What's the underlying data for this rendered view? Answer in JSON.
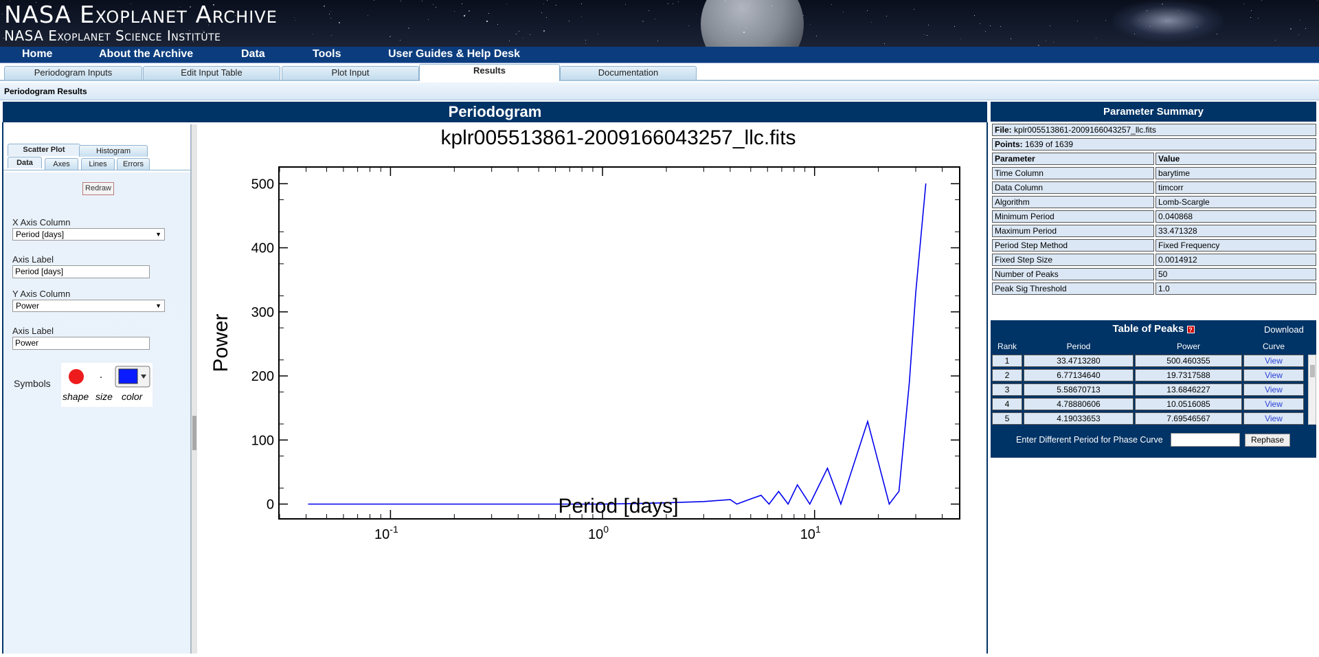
{
  "site": {
    "title": "NASA Exoplanet Archive",
    "subtitle": "NASA Exoplanet Science Institute"
  },
  "nav": [
    "Home",
    "About the Archive",
    "Data",
    "Tools",
    "User Guides & Help Desk"
  ],
  "tabs": [
    "Periodogram Inputs",
    "Edit Input Table",
    "Plot Input",
    "Results",
    "Documentation"
  ],
  "active_tab": "Results",
  "results_bar": "Periodogram Results",
  "main_header": "Periodogram",
  "controls": {
    "plot_tabs": [
      "Scatter Plot",
      "Histogram"
    ],
    "sub_tabs": [
      "Data",
      "Axes",
      "Lines",
      "Errors"
    ],
    "redraw": "Redraw",
    "x_axis_column_label": "X Axis Column",
    "x_axis_column_value": "Period [days]",
    "x_axis_label_label": "Axis Label",
    "x_axis_label_value": "Period [days]",
    "y_axis_column_label": "Y Axis Column",
    "y_axis_column_value": "Power",
    "y_axis_label_label": "Axis Label",
    "y_axis_label_value": "Power",
    "symbols_label": "Symbols",
    "symbol_shape": "shape",
    "symbol_size": "size",
    "symbol_color": "color",
    "symbol_shape_color": "#ee1c1c",
    "symbol_fill_color": "#0a1cff"
  },
  "plot": {
    "title": "kplr005513861-2009166043257_llc.fits",
    "line_color": "#0000ee"
  },
  "chart_data": {
    "type": "line",
    "title": "kplr005513861-2009166043257_llc.fits",
    "xlabel": "Period [days]",
    "ylabel": "Power",
    "xscale": "log",
    "xlim": [
      0.03,
      48
    ],
    "ylim": [
      -22,
      525
    ],
    "yticks": [
      0,
      100,
      200,
      300,
      400,
      500
    ],
    "xtick_labels": [
      "10^-1",
      "10^0",
      "10^1"
    ],
    "grid": false,
    "series": [
      {
        "x": [
          0.0409,
          1.0,
          1.5,
          2.0,
          3.0,
          4.0,
          4.3,
          5.0,
          5.59,
          6.1,
          6.77,
          7.5,
          8.3,
          9.5,
          11.5,
          13.3,
          17.8,
          22.5,
          25.0,
          28.0,
          30.0,
          33.47
        ],
        "y": [
          0,
          0,
          1,
          2,
          4,
          7,
          0,
          8,
          13.7,
          0,
          19.7,
          0,
          30,
          0,
          56,
          0,
          129,
          0,
          20,
          190,
          330,
          500.46
        ]
      }
    ]
  },
  "summary": {
    "header": "Parameter Summary",
    "file_label": "File:",
    "file_value": "kplr005513861-2009166043257_llc.fits",
    "points_label": "Points:",
    "points_value": "1639 of 1639",
    "col_parameter": "Parameter",
    "col_value": "Value",
    "rows": [
      {
        "param": "Time Column",
        "value": "barytime"
      },
      {
        "param": "Data Column",
        "value": "timcorr"
      },
      {
        "param": "Algorithm",
        "value": "Lomb-Scargle"
      },
      {
        "param": "Minimum Period",
        "value": "0.040868"
      },
      {
        "param": "Maximum Period",
        "value": "33.471328"
      },
      {
        "param": "Period Step Method",
        "value": "Fixed Frequency"
      },
      {
        "param": "Fixed Step Size",
        "value": "0.0014912"
      },
      {
        "param": "Number of Peaks",
        "value": "50"
      },
      {
        "param": "Peak Sig Threshold",
        "value": "1.0"
      }
    ]
  },
  "peaks": {
    "header": "Table of Peaks",
    "download": "Download",
    "columns": [
      "Rank",
      "Period",
      "Power",
      "Curve"
    ],
    "rows": [
      {
        "rank": "1",
        "period": "33.4713280",
        "power": "500.460355",
        "curve": "View"
      },
      {
        "rank": "2",
        "period": "6.77134640",
        "power": "19.7317588",
        "curve": "View"
      },
      {
        "rank": "3",
        "period": "5.58670713",
        "power": "13.6846227",
        "curve": "View"
      },
      {
        "rank": "4",
        "period": "4.78880606",
        "power": "10.0516085",
        "curve": "View"
      },
      {
        "rank": "5",
        "period": "4.19033653",
        "power": "7.69546567",
        "curve": "View"
      }
    ],
    "rephase_label": "Enter Different Period for Phase Curve",
    "rephase_button": "Rephase"
  }
}
